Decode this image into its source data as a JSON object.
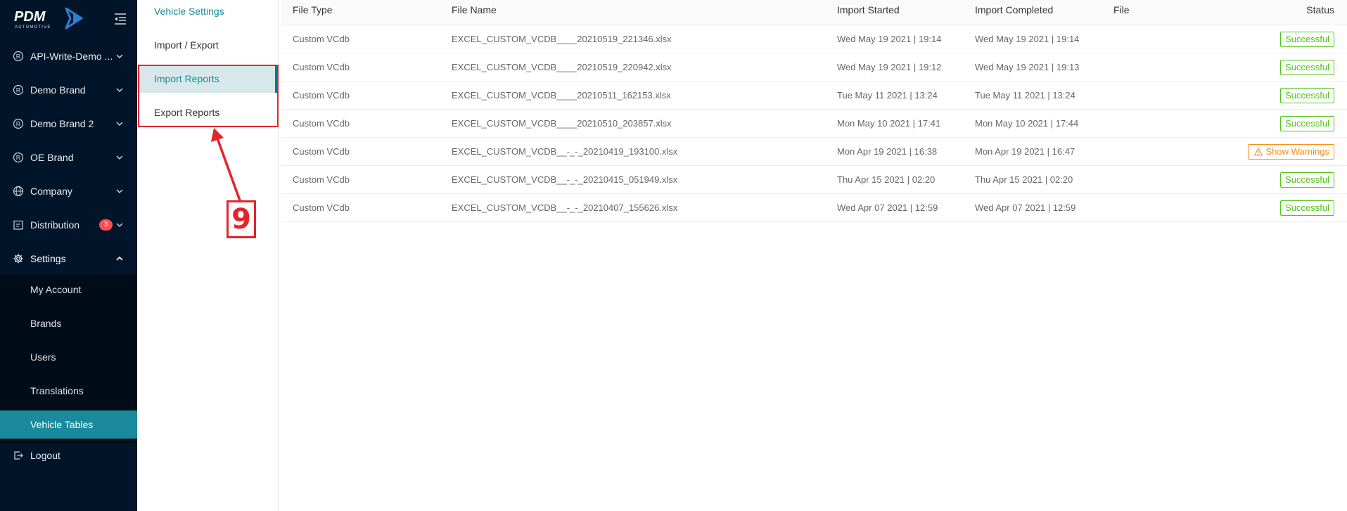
{
  "logo": {
    "name": "PDM",
    "sub": "AUTOMOTIVE"
  },
  "sidebar": {
    "items": [
      {
        "label": "API-Write-Demo ...",
        "icon": "registered-icon"
      },
      {
        "label": "Demo Brand",
        "icon": "registered-icon"
      },
      {
        "label": "Demo Brand 2",
        "icon": "registered-icon"
      },
      {
        "label": "OE Brand",
        "icon": "registered-icon"
      },
      {
        "label": "Company",
        "icon": "globe-icon"
      },
      {
        "label": "Distribution",
        "icon": "calendar-icon",
        "badge": "3"
      },
      {
        "label": "Settings",
        "icon": "gear-icon"
      }
    ],
    "settings_sub": [
      {
        "label": "My Account"
      },
      {
        "label": "Brands"
      },
      {
        "label": "Users"
      },
      {
        "label": "Translations"
      },
      {
        "label": "Vehicle Tables"
      }
    ],
    "logout": "Logout"
  },
  "secondary_menu": {
    "items": [
      {
        "label": "Vehicle Settings"
      },
      {
        "label": "Import / Export"
      },
      {
        "label": "Import Reports"
      },
      {
        "label": "Export Reports"
      }
    ]
  },
  "annotation": {
    "number": "9"
  },
  "table": {
    "headers": [
      "File Type",
      "File Name",
      "Import Started",
      "Import Completed",
      "File",
      "Status"
    ],
    "rows": [
      {
        "type": "Custom VCdb",
        "name": "EXCEL_CUSTOM_VCDB____20210519_221346.xlsx",
        "started": "Wed May 19 2021 | 19:14",
        "completed": "Wed May 19 2021 | 19:14",
        "status": "Successful"
      },
      {
        "type": "Custom VCdb",
        "name": "EXCEL_CUSTOM_VCDB____20210519_220942.xlsx",
        "started": "Wed May 19 2021 | 19:12",
        "completed": "Wed May 19 2021 | 19:13",
        "status": "Successful"
      },
      {
        "type": "Custom VCdb",
        "name": "EXCEL_CUSTOM_VCDB____20210511_162153.xlsx",
        "started": "Tue May 11 2021 | 13:24",
        "completed": "Tue May 11 2021 | 13:24",
        "status": "Successful"
      },
      {
        "type": "Custom VCdb",
        "name": "EXCEL_CUSTOM_VCDB____20210510_203857.xlsx",
        "started": "Mon May 10 2021 | 17:41",
        "completed": "Mon May 10 2021 | 17:44",
        "status": "Successful"
      },
      {
        "type": "Custom VCdb",
        "name": "EXCEL_CUSTOM_VCDB__-_-_20210419_193100.xlsx",
        "started": "Mon Apr 19 2021 | 16:38",
        "completed": "Mon Apr 19 2021 | 16:47",
        "status": "Show Warnings"
      },
      {
        "type": "Custom VCdb",
        "name": "EXCEL_CUSTOM_VCDB__-_-_20210415_051949.xlsx",
        "started": "Thu Apr 15 2021 | 02:20",
        "completed": "Thu Apr 15 2021 | 02:20",
        "status": "Successful"
      },
      {
        "type": "Custom VCdb",
        "name": "EXCEL_CUSTOM_VCDB__-_-_20210407_155626.xlsx",
        "started": "Wed Apr 07 2021 | 12:59",
        "completed": "Wed Apr 07 2021 | 12:59",
        "status": "Successful"
      }
    ]
  },
  "colors": {
    "sidebar_bg": "#001529",
    "active_item": "#1a8a9c",
    "success": "#52c41a",
    "warning": "#fa8c16",
    "annotation": "#e3242b"
  }
}
